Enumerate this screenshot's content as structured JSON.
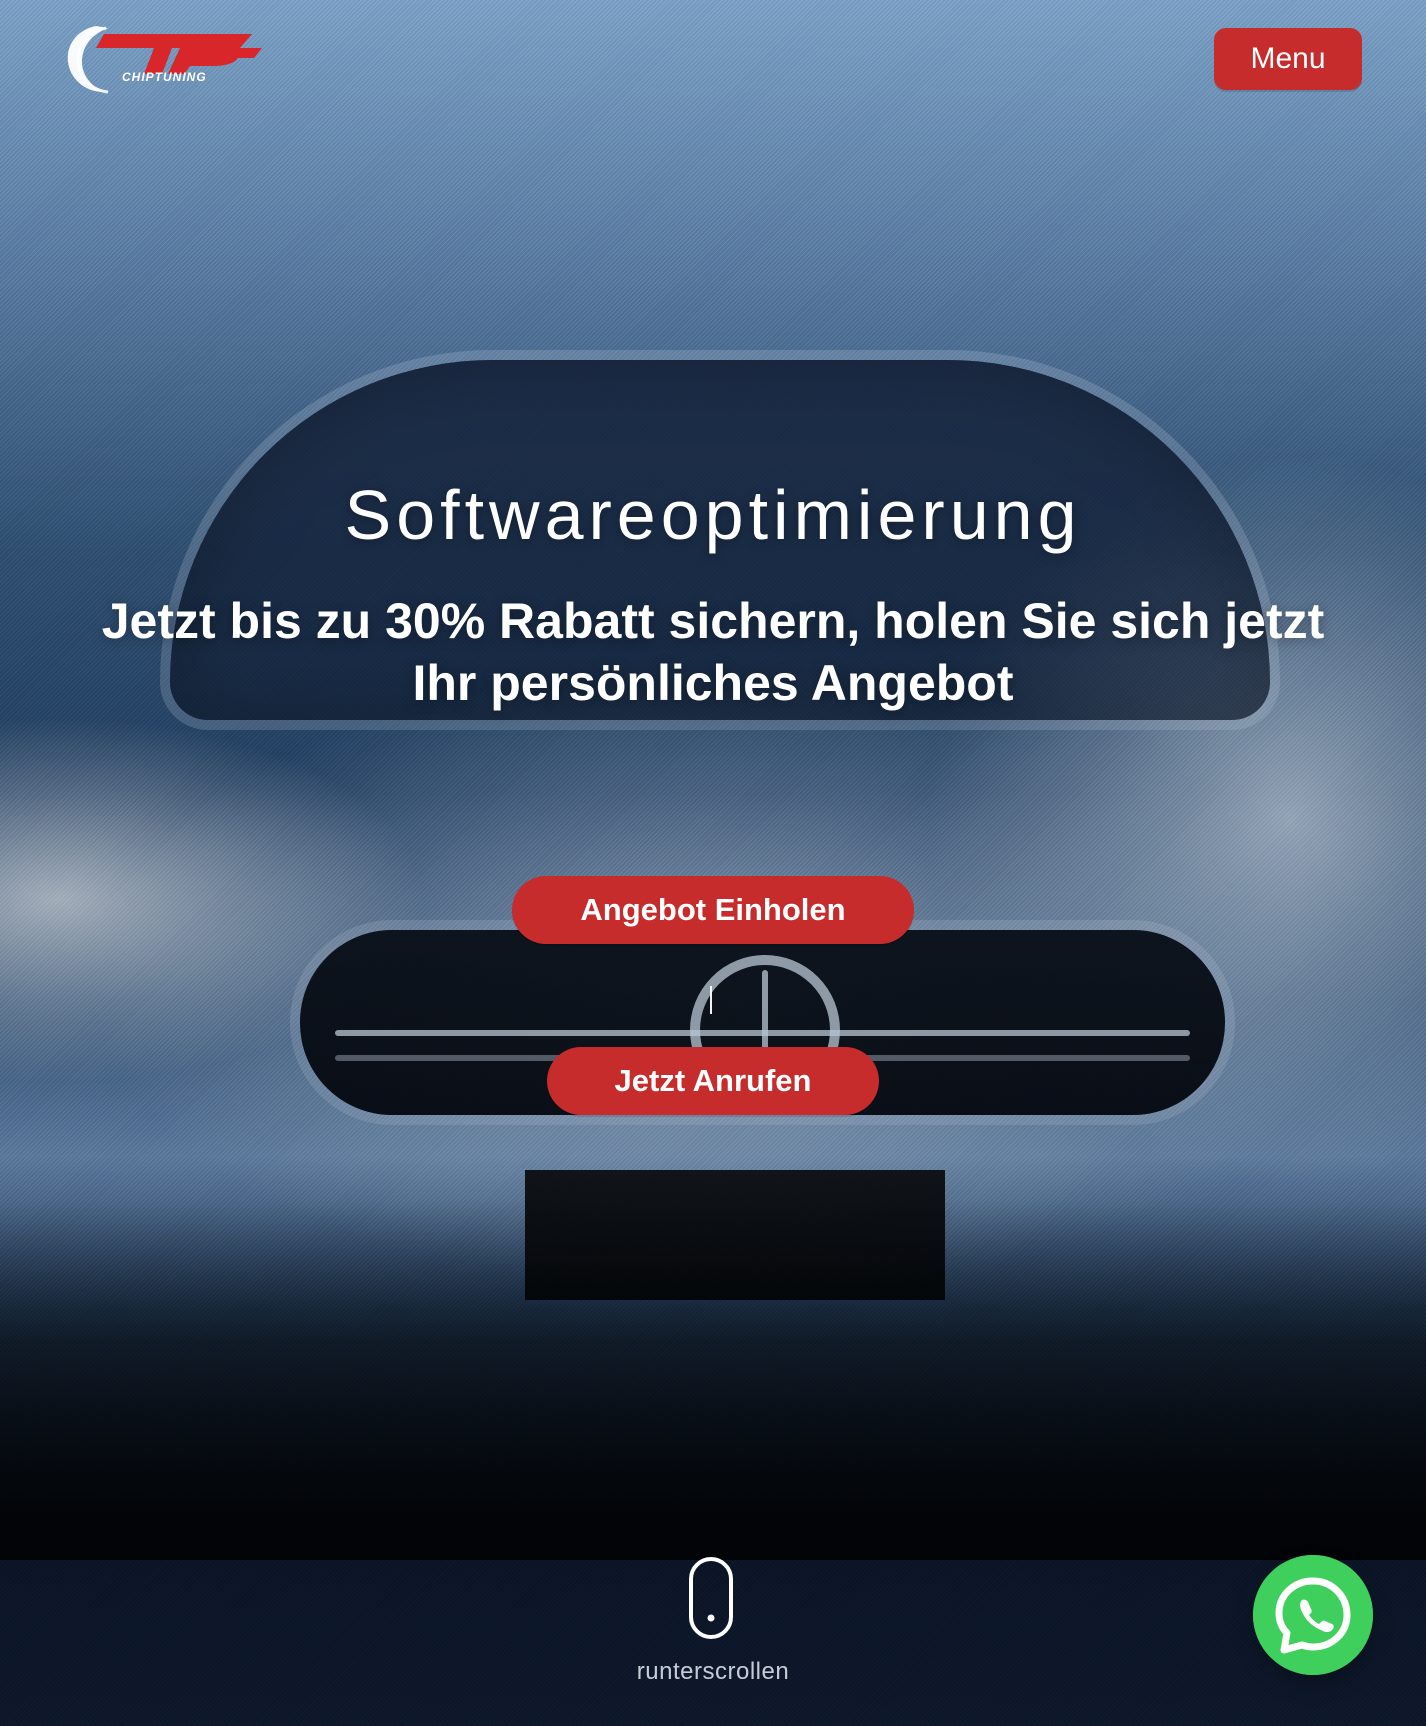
{
  "brand": {
    "logo_text": "CHIPTUNING"
  },
  "nav": {
    "menu_label": "Menu"
  },
  "hero": {
    "title": "Softwareoptimierung",
    "subtitle": "Jetzt bis zu 30% Rabatt sichern, holen Sie sich jetzt Ihr persönliches Angebot",
    "buttons": {
      "offer": "Angebot Einholen",
      "call": "Jetzt Anrufen"
    }
  },
  "scroll": {
    "label": "runterscrollen",
    "icon": "mouse-scroll-icon"
  },
  "floating": {
    "whatsapp_icon": "whatsapp-icon"
  },
  "colors": {
    "accent_red": "#c62c2c",
    "whatsapp_green": "#3ecf5c"
  }
}
